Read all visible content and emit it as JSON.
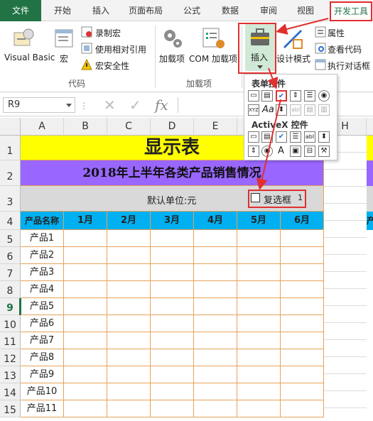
{
  "ribbon_tabs": [
    "文件",
    "开始",
    "插入",
    "页面布局",
    "公式",
    "数据",
    "审阅",
    "视图",
    "开发工具"
  ],
  "ribbon": {
    "visual_basic": "Visual Basic",
    "macros": "宏",
    "record_macro": "录制宏",
    "relative_ref": "使用相对引用",
    "macro_security": "宏安全性",
    "group_code": "代码",
    "addins": "加载项",
    "com_addins": "COM 加载项",
    "group_addins": "加载项",
    "insert": "插入",
    "design_mode": "设计模式",
    "properties": "属性",
    "view_code": "查看代码",
    "run_dialog": "执行对话框"
  },
  "dropdown": {
    "form_controls": "表单控件",
    "activex_controls": "ActiveX 控件",
    "activex_aa": "Aa",
    "activex_a": "A",
    "activex_abl": "abl"
  },
  "formula_bar": {
    "name_box": "R9",
    "fx": "fx"
  },
  "columns": [
    "A",
    "B",
    "C",
    "D",
    "E",
    "F",
    "G",
    "H"
  ],
  "rows": [
    "1",
    "2",
    "3",
    "4",
    "5",
    "6",
    "7",
    "8",
    "9",
    "10",
    "11",
    "12",
    "13",
    "14",
    "15"
  ],
  "selected_row": "9",
  "sheet": {
    "title": "显示表",
    "subtitle": "2018年上半年各类产品销售情况",
    "unit": "默认单位:元",
    "checkbox_label": "复选框",
    "checkbox_index": "1",
    "header_name": "产品名称",
    "months": [
      "1月",
      "2月",
      "3月",
      "4月",
      "5月",
      "6月"
    ],
    "products": [
      "产品1",
      "产品2",
      "产品3",
      "产品4",
      "产品5",
      "产品6",
      "产品7",
      "产品8",
      "产品9",
      "产品10",
      "产品11"
    ],
    "right_clipped": "产"
  },
  "colors": {
    "excel_green": "#217346",
    "title_yellow": "#ffff00",
    "subtitle_purple": "#9966ff",
    "header_blue": "#00b0f0",
    "unit_gray": "#d9d9d9",
    "grid_orange": "#e6a35a",
    "annotation_red": "#e03030"
  }
}
